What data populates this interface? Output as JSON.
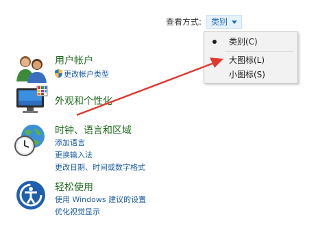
{
  "viewby": {
    "label": "查看方式:",
    "selected": "类别",
    "options": [
      {
        "label": "类别(C)",
        "checked": true
      },
      {
        "label": "大图标(L)",
        "checked": false
      },
      {
        "label": "小图标(S)",
        "checked": false
      }
    ]
  },
  "categories": [
    {
      "title": "用户帐户",
      "links": [
        "更改帐户类型"
      ],
      "icon": "users-icon"
    },
    {
      "title": "外观和个性化",
      "links": [],
      "icon": "appearance-monitor-icon"
    },
    {
      "title": "时钟、语言和区域",
      "links": [
        "添加语言",
        "更换输入法",
        "更改日期、时间或数字格式"
      ],
      "icon": "clock-globe-icon"
    },
    {
      "title": "轻松使用",
      "links": [
        "使用 Windows 建议的设置",
        "优化视觉显示"
      ],
      "icon": "ease-of-access-icon"
    }
  ],
  "colors": {
    "link": "#1b5ca6",
    "title": "#1f6b1f",
    "arrow": "#e03a2e",
    "select_bg": "#e5f1fb"
  }
}
